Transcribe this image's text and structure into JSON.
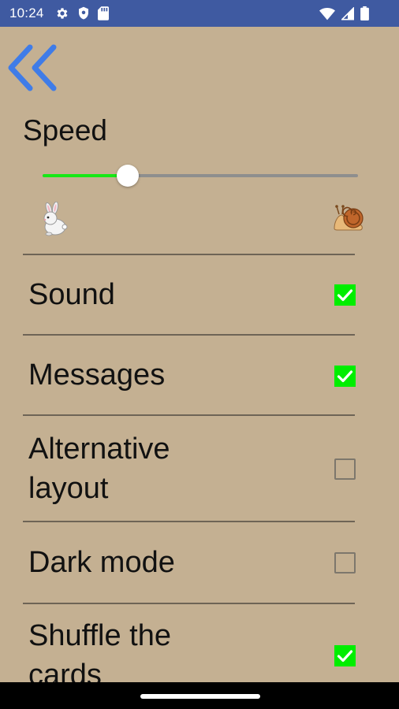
{
  "status_bar": {
    "time": "10:24",
    "left_icons": [
      "gear-icon",
      "shield-icon",
      "sd-card-icon"
    ],
    "right_icons": [
      "wifi-icon",
      "signal-icon",
      "battery-icon"
    ],
    "background": "#3f5aa1"
  },
  "header": {
    "back_icon": "double-chevron-left-icon",
    "accent": "#3f7ce8"
  },
  "speed": {
    "title": "Speed",
    "level": 0.27,
    "fast_icon": "rabbit-icon",
    "slow_icon": "snail-icon",
    "fill_color": "#16e816"
  },
  "settings": [
    {
      "label": "Sound",
      "checked": true
    },
    {
      "label": "Messages",
      "checked": true
    },
    {
      "label": "Alternative\nlayout",
      "checked": false
    },
    {
      "label": "Dark mode",
      "checked": false
    },
    {
      "label": "Shuffle the\ncards",
      "checked": true
    }
  ],
  "theme": {
    "background": "#c4b092",
    "checkbox_on": "#00ee00"
  }
}
